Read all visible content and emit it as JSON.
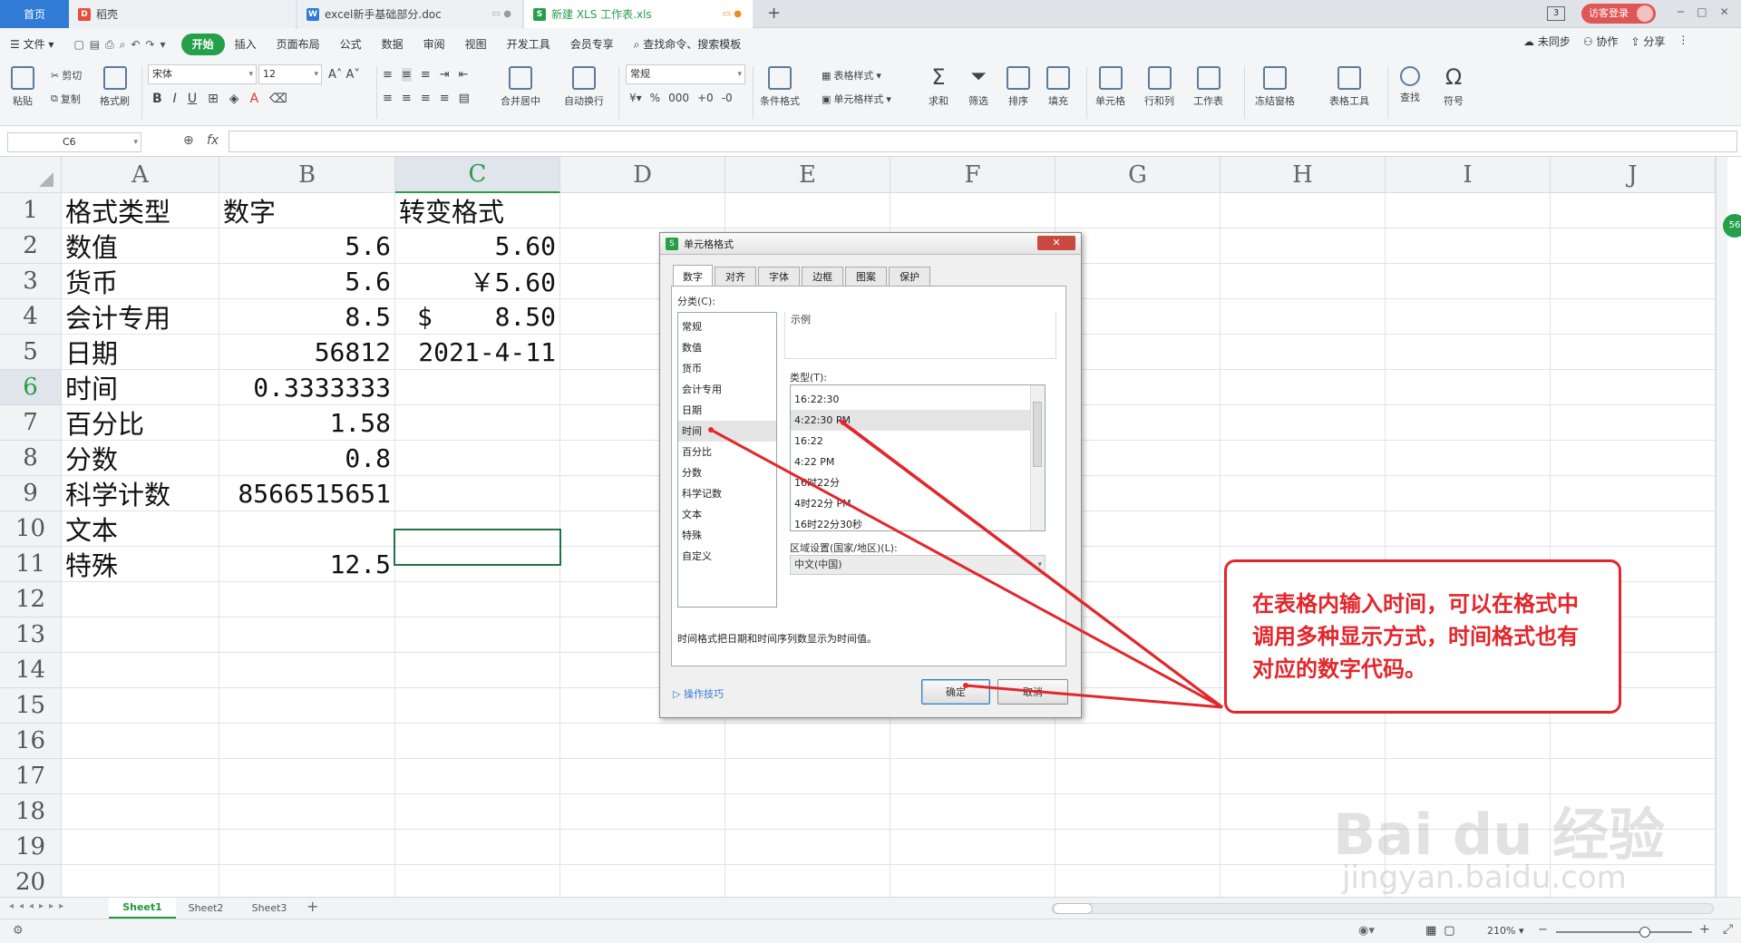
{
  "tabs": {
    "home": "首页",
    "t1": "稻壳",
    "t2": "excel新手基础部分.doc",
    "t3": "新建 XLS 工作表.xls",
    "new_tab": "+",
    "badge": "3",
    "login": "访客登录"
  },
  "menu": {
    "file": "文件",
    "items": [
      "开始",
      "插入",
      "页面布局",
      "公式",
      "数据",
      "审阅",
      "视图",
      "开发工具",
      "会员专享"
    ],
    "search": "查找命令、搜索模板",
    "right": [
      "未同步",
      "协作",
      "分享"
    ]
  },
  "ribbon": {
    "paste": "粘贴",
    "cut": "剪切",
    "copy": "复制",
    "format_painter": "格式刷",
    "font": "宋体",
    "font_size": "12",
    "bold": "B",
    "italic": "I",
    "underline": "U",
    "merge": "合并居中",
    "wrap": "自动换行",
    "number_format": "常规",
    "cond_format": "条件格式",
    "table_style": "表格样式",
    "cell_style": "单元格样式",
    "sum": "求和",
    "filter": "筛选",
    "sort": "排序",
    "fill": "填充",
    "cell": "单元格",
    "rowcol": "行和列",
    "sheet": "工作表",
    "freeze": "冻结窗格",
    "table_tools": "表格工具",
    "find": "查找",
    "symbol": "符号"
  },
  "formula_bar": {
    "name_box": "C6",
    "fx": "fx",
    "value": ""
  },
  "grid": {
    "columns": [
      "A",
      "B",
      "C",
      "D",
      "E",
      "F",
      "G",
      "H",
      "I",
      "J"
    ],
    "rows": [
      "1",
      "2",
      "3",
      "4",
      "5",
      "6",
      "7",
      "8",
      "9",
      "10",
      "11",
      "12",
      "13",
      "14",
      "15",
      "16",
      "17",
      "18",
      "19",
      "20"
    ],
    "data": [
      [
        "格式类型",
        "数字",
        "转变格式"
      ],
      [
        "数值",
        "5.6",
        "5.60"
      ],
      [
        "货币",
        "5.6",
        "￥5.60"
      ],
      [
        "会计专用",
        "8.5",
        "$",
        "8.50"
      ],
      [
        "日期",
        "56812",
        "2021-4-11"
      ],
      [
        "时间",
        "0.3333333",
        ""
      ],
      [
        "百分比",
        "1.58",
        ""
      ],
      [
        "分数",
        "0.8",
        ""
      ],
      [
        "科学计数",
        "8566515651",
        ""
      ],
      [
        "文本",
        "",
        ""
      ],
      [
        "特殊",
        "12.5",
        ""
      ]
    ]
  },
  "sheets": [
    "Sheet1",
    "Sheet2",
    "Sheet3"
  ],
  "status": {
    "zoom": "210%"
  },
  "dialog": {
    "title": "单元格格式",
    "tabs": [
      "数字",
      "对齐",
      "字体",
      "边框",
      "图案",
      "保护"
    ],
    "category_label": "分类(C):",
    "categories": [
      "常规",
      "数值",
      "货币",
      "会计专用",
      "日期",
      "时间",
      "百分比",
      "分数",
      "科学记数",
      "文本",
      "特殊",
      "自定义"
    ],
    "sample_label": "示例",
    "type_label": "类型(T):",
    "types": [
      "16:22:30",
      "4:22:30 PM",
      "16:22",
      "4:22 PM",
      "16时22分",
      "4时22分 PM",
      "16时22分30秒"
    ],
    "locale_label": "区域设置(国家/地区)(L):",
    "locale_value": "中文(中国)",
    "description": "时间格式把日期和时间序列数显示为时间值。",
    "tips": "操作技巧",
    "ok": "确定",
    "cancel": "取消"
  },
  "callout": {
    "text": "在表格内输入时间，可以在格式中调用多种显示方式，时间格式也有对应的数字代码。"
  },
  "watermark": {
    "brand": "Bai du 经验",
    "url": "jingyan.baidu.com"
  },
  "colors": {
    "accent_green": "#25a04a",
    "annotation_red": "#e3262b",
    "tab_blue": "#2f7bd6"
  }
}
